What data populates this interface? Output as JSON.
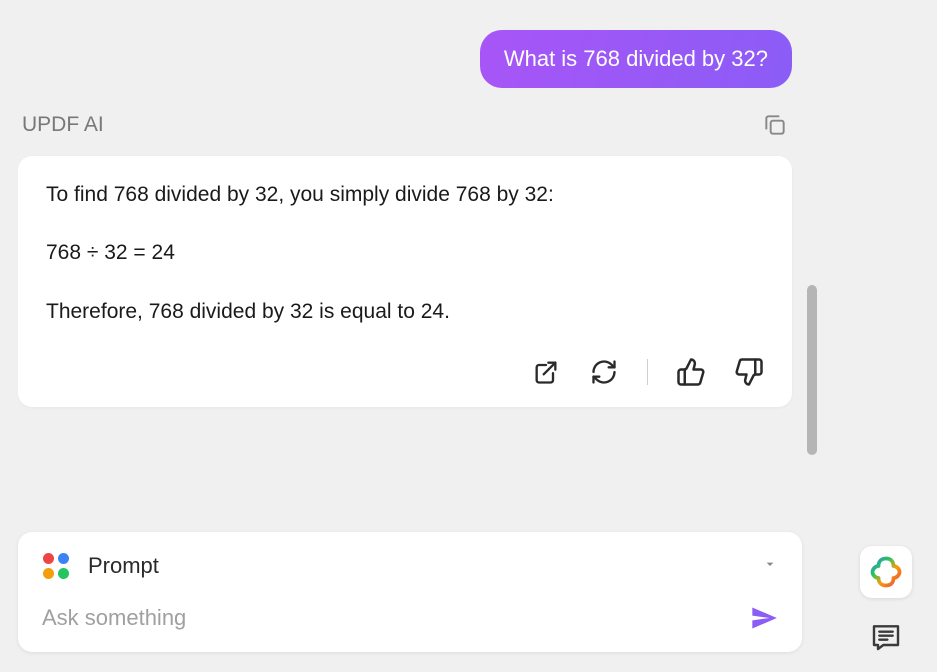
{
  "user_message": "What is 768 divided by 32?",
  "ai_label": "UPDF AI",
  "ai_response": {
    "line1": "To find 768 divided by 32, you simply divide 768 by 32:",
    "line2": "768 ÷ 32 = 24",
    "line3": "Therefore, 768 divided by 32 is equal to 24."
  },
  "prompt_label": "Prompt",
  "input_placeholder": "Ask something"
}
